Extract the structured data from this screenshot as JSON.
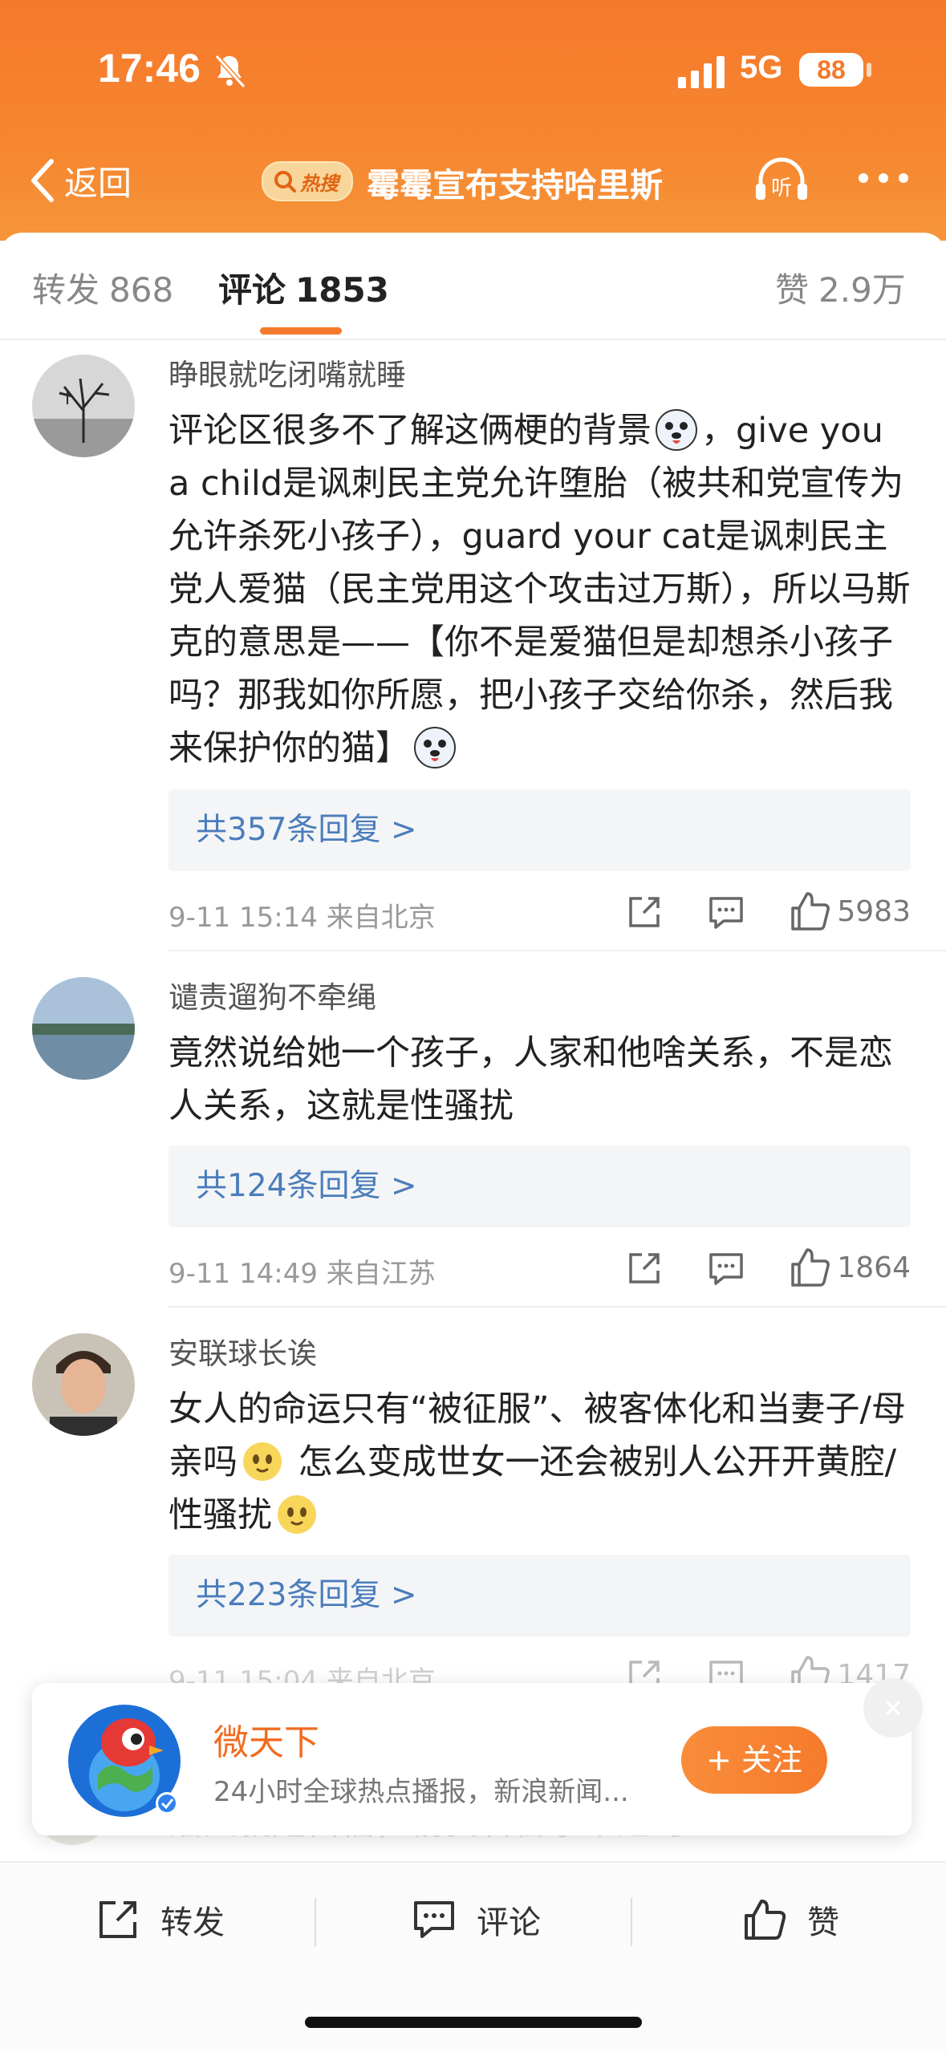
{
  "status_bar": {
    "time": "17:46",
    "network": "5G",
    "battery": "88"
  },
  "nav": {
    "back_label": "返回",
    "hot_badge": "热搜",
    "title": "霉霉宣布支持哈里斯",
    "listen_label": "听"
  },
  "tabs": [
    {
      "label": "转发",
      "count": "868"
    },
    {
      "label": "评论",
      "count": "1853"
    },
    {
      "label": "赞",
      "count": "2.9万"
    }
  ],
  "comments": [
    {
      "user": "睁眼就吃闭嘴就睡",
      "text_part1": "评论区很多不了解这俩梗的背景",
      "text_part2": "，give you a child是讽刺民主党允许堕胎（被共和党宣传为允许杀死小孩子），guard your cat是讽刺民主党人爱猫（民主党用这个攻击过万斯），所以马斯克的意思是——【你不是爱猫但是却想杀小孩子吗？那我如你所愿，把小孩子交给你杀，然后我来保护你的猫】",
      "emoji": "doge",
      "replies": "共357条回复 >",
      "time_location": "9-11 15:14  来自北京",
      "likes": "5983"
    },
    {
      "user": "谴责遛狗不牵绳",
      "text": "竟然说给她一个孩子，人家和他啥关系，不是恋人关系，这就是性骚扰",
      "replies": "共124条回复 >",
      "time_location": "9-11 14:49  来自江苏",
      "likes": "1864"
    },
    {
      "user": "安联球长诶",
      "text_part1": "女人的命运只有“被征服”、被客体化和当妻子/母亲吗",
      "text_part2": " 怎么变成世女一还会被别人公开开黄腔/性骚扰",
      "emoji": "melting-face",
      "replies": "共223条回复 >",
      "time_location": "9-11 15:04  来自北京",
      "likes": "1417"
    }
  ],
  "ghost_text": "活人就是自信，杨安名言永不过时",
  "promo": {
    "name": "微天下",
    "description": "24小时全球热点播报，新浪新闻...",
    "follow_label": "+ 关注"
  },
  "bottom_bar": {
    "repost": "转发",
    "comment": "评论",
    "like": "赞"
  },
  "colors": {
    "accent": "#f57a2c",
    "link": "#4a7dbb"
  }
}
